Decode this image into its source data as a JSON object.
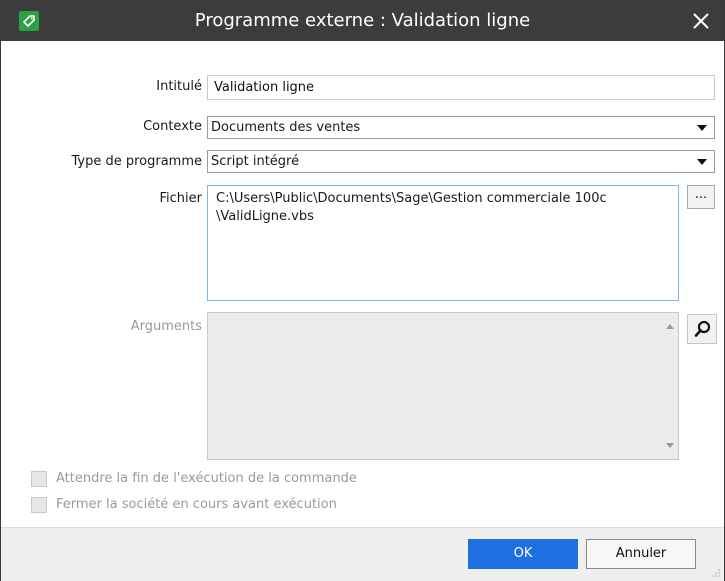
{
  "window": {
    "title": "Programme externe : Validation ligne",
    "app_icon": "sage-tag-icon",
    "close_icon": "close-icon"
  },
  "form": {
    "intitule_label": "Intitulé",
    "intitule_value": "Validation ligne",
    "contexte_label": "Contexte",
    "contexte_value": "Documents des ventes",
    "type_label": "Type de programme",
    "type_value": "Script intégré",
    "fichier_label": "Fichier",
    "fichier_line1": "C:\\Users\\Public\\Documents\\Sage\\Gestion commerciale 100c",
    "fichier_line2": "\\ValidLigne.vbs",
    "browse_label": "...",
    "arguments_label": "Arguments",
    "arguments_value": ""
  },
  "options": {
    "attendre_label": "Attendre la fin de l'exécution de la commande",
    "attendre_checked": false,
    "fermer_label": "Fermer la société en cours avant exécution",
    "fermer_checked": false
  },
  "footer": {
    "ok_label": "OK",
    "cancel_label": "Annuler"
  },
  "colors": {
    "titlebar": "#3c3c3c",
    "accent": "#1f6fe0",
    "icon_green": "#2ea043"
  }
}
